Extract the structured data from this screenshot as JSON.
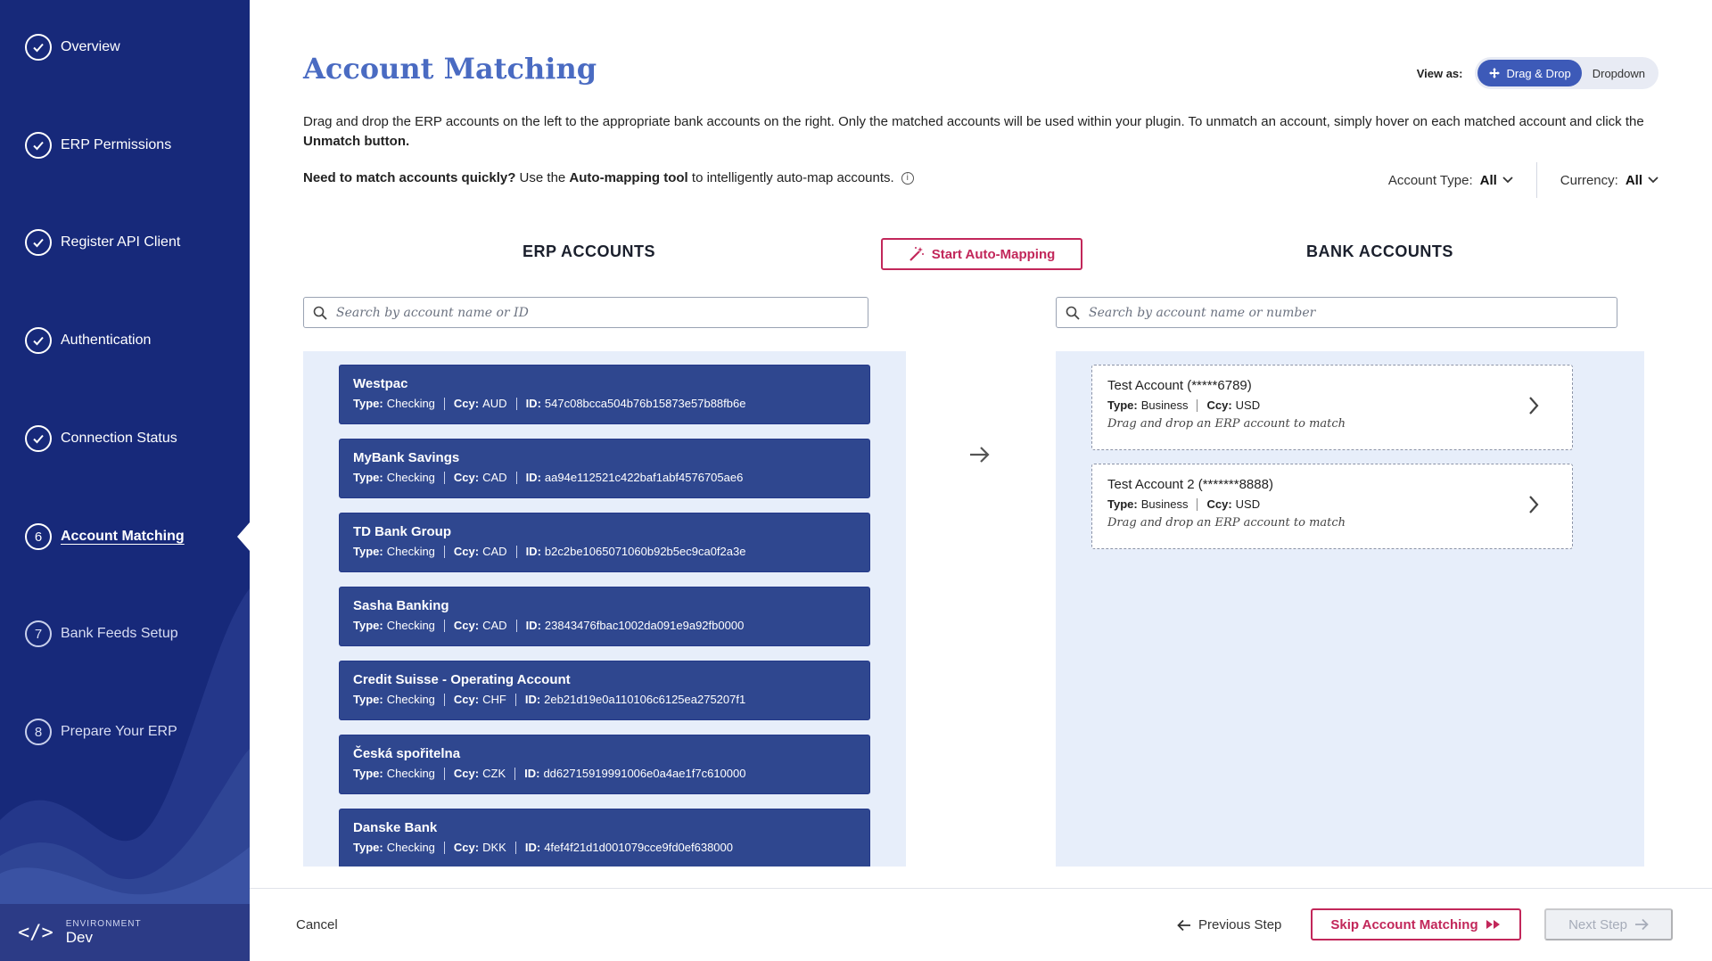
{
  "sidebar": {
    "items": [
      {
        "label": "Overview",
        "state": "done"
      },
      {
        "label": "ERP Permissions",
        "state": "done"
      },
      {
        "label": "Register API Client",
        "state": "done"
      },
      {
        "label": "Authentication",
        "state": "done"
      },
      {
        "label": "Connection Status",
        "state": "done"
      },
      {
        "label": "Account Matching",
        "step": "6",
        "state": "active"
      },
      {
        "label": "Bank Feeds Setup",
        "step": "7",
        "state": "pending"
      },
      {
        "label": "Prepare Your ERP",
        "step": "8",
        "state": "pending"
      }
    ],
    "environment": {
      "label": "ENVIRONMENT",
      "value": "Dev"
    }
  },
  "header": {
    "title": "Account Matching",
    "view_as_label": "View as:",
    "view_options": [
      "Drag & Drop",
      "Dropdown"
    ],
    "selected_view": "Drag & Drop"
  },
  "description": {
    "text": "Drag and drop the ERP accounts on the left to the appropriate bank accounts on the right. Only the matched accounts will be used within your plugin. To unmatch an account, simply hover on each matched account and click the ",
    "bold_tail": "Unmatch button.",
    "quick_bold": "Need to match accounts quickly?",
    "quick_mid": " Use the ",
    "quick_tool": "Auto-mapping tool",
    "quick_tail": " to intelligently auto-map accounts."
  },
  "filters": {
    "account_type_label": "Account Type:",
    "account_type_value": "All",
    "currency_label": "Currency:",
    "currency_value": "All"
  },
  "erp": {
    "heading": "ERP ACCOUNTS",
    "search_placeholder": "Search by account name or ID",
    "type_label": "Type:",
    "ccy_label": "Ccy:",
    "id_label": "ID:",
    "accounts": [
      {
        "name": "Westpac",
        "type": "Checking",
        "ccy": "AUD",
        "id": "547c08bcca504b76b15873e57b88fb6e"
      },
      {
        "name": "MyBank Savings",
        "type": "Checking",
        "ccy": "CAD",
        "id": "aa94e112521c422baf1abf4576705ae6"
      },
      {
        "name": "TD Bank Group",
        "type": "Checking",
        "ccy": "CAD",
        "id": "b2c2be1065071060b92b5ec9ca0f2a3e"
      },
      {
        "name": "Sasha Banking",
        "type": "Checking",
        "ccy": "CAD",
        "id": "23843476fbac1002da091e9a92fb0000"
      },
      {
        "name": "Credit Suisse - Operating Account",
        "type": "Checking",
        "ccy": "CHF",
        "id": "2eb21d19e0a110106c6125ea275207f1"
      },
      {
        "name": "Česká spořitelna",
        "type": "Checking",
        "ccy": "CZK",
        "id": "dd62715919991006e0a4ae1f7c610000"
      },
      {
        "name": "Danske Bank",
        "type": "Checking",
        "ccy": "DKK",
        "id": "4fef4f21d1d001079cce9fd0ef638000"
      }
    ]
  },
  "auto_mapping_label": "Start Auto-Mapping",
  "bank": {
    "heading": "BANK ACCOUNTS",
    "search_placeholder": "Search by account name or number",
    "type_label": "Type:",
    "ccy_label": "Ccy:",
    "accounts": [
      {
        "name": "Test Account (*****6789)",
        "type": "Business",
        "ccy": "USD",
        "hint": "Drag and drop an ERP account to match"
      },
      {
        "name": "Test Account 2 (*******8888)",
        "type": "Business",
        "ccy": "USD",
        "hint": "Drag and drop an ERP account to match"
      }
    ]
  },
  "footer": {
    "cancel": "Cancel",
    "previous": "Previous Step",
    "skip": "Skip Account Matching",
    "next": "Next Step"
  },
  "colors": {
    "sidebar": "#17297a",
    "accent": "#c2275a",
    "card": "#2f478f",
    "title": "#4a6bc2"
  }
}
